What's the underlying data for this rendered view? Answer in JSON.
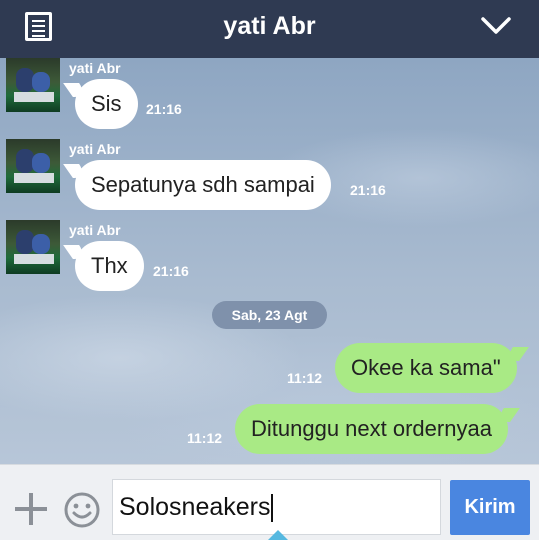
{
  "header": {
    "title": "yati Abr",
    "menu_icon": "list-icon",
    "collapse_icon": "chevron-down-icon"
  },
  "messages": [
    {
      "sender": "yati Abr",
      "text": "Sis",
      "time": "21:16",
      "direction": "incoming"
    },
    {
      "sender": "yati Abr",
      "text": "Sepatunya sdh sampai",
      "time": "21:16",
      "direction": "incoming"
    },
    {
      "sender": "yati Abr",
      "text": "Thx",
      "time": "21:16",
      "direction": "incoming"
    },
    {
      "text": "Okee ka sama\"",
      "time": "11:12",
      "direction": "outgoing"
    },
    {
      "text": "Ditunggu next ordernyaa",
      "time": "11:12",
      "direction": "outgoing"
    }
  ],
  "date_separator": "Sab, 23 Agt",
  "composer": {
    "value": "Solosneakers",
    "send_label": "Kirim",
    "add_icon": "plus-icon",
    "emoji_icon": "smiley-icon"
  },
  "colors": {
    "header_bg": "#2f3a52",
    "outgoing_bubble": "#a9ea85",
    "incoming_bubble": "#ffffff",
    "send_button": "#4a86e0"
  }
}
